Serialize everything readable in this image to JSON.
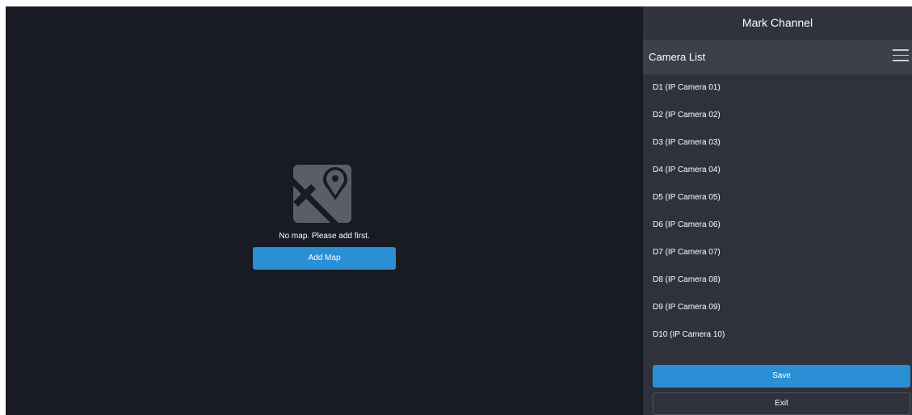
{
  "map_area": {
    "empty_message": "No map. Please add first.",
    "add_map_label": "Add Map",
    "icon": "map-pin-icon"
  },
  "panel": {
    "title": "Mark Channel",
    "camera_list_label": "Camera List",
    "menu_icon": "menu-icon",
    "cameras": [
      {
        "label": "D1 (IP Camera 01)"
      },
      {
        "label": "D2 (IP Camera 02)"
      },
      {
        "label": "D3 (IP Camera 03)"
      },
      {
        "label": "D4 (IP Camera 04)"
      },
      {
        "label": "D5 (IP Camera 05)"
      },
      {
        "label": "D6 (IP Camera 06)"
      },
      {
        "label": "D7 (IP Camera 07)"
      },
      {
        "label": "D8 (IP Camera 08)"
      },
      {
        "label": "D9 (IP Camera 09)"
      },
      {
        "label": "D10 (IP Camera 10)"
      }
    ],
    "save_label": "Save",
    "exit_label": "Exit"
  },
  "colors": {
    "map_background": "#181b23",
    "panel_background": "#2f323c",
    "header_background": "#3c404b",
    "accent": "#2a8fd4",
    "icon_gray": "#5a5e68"
  }
}
